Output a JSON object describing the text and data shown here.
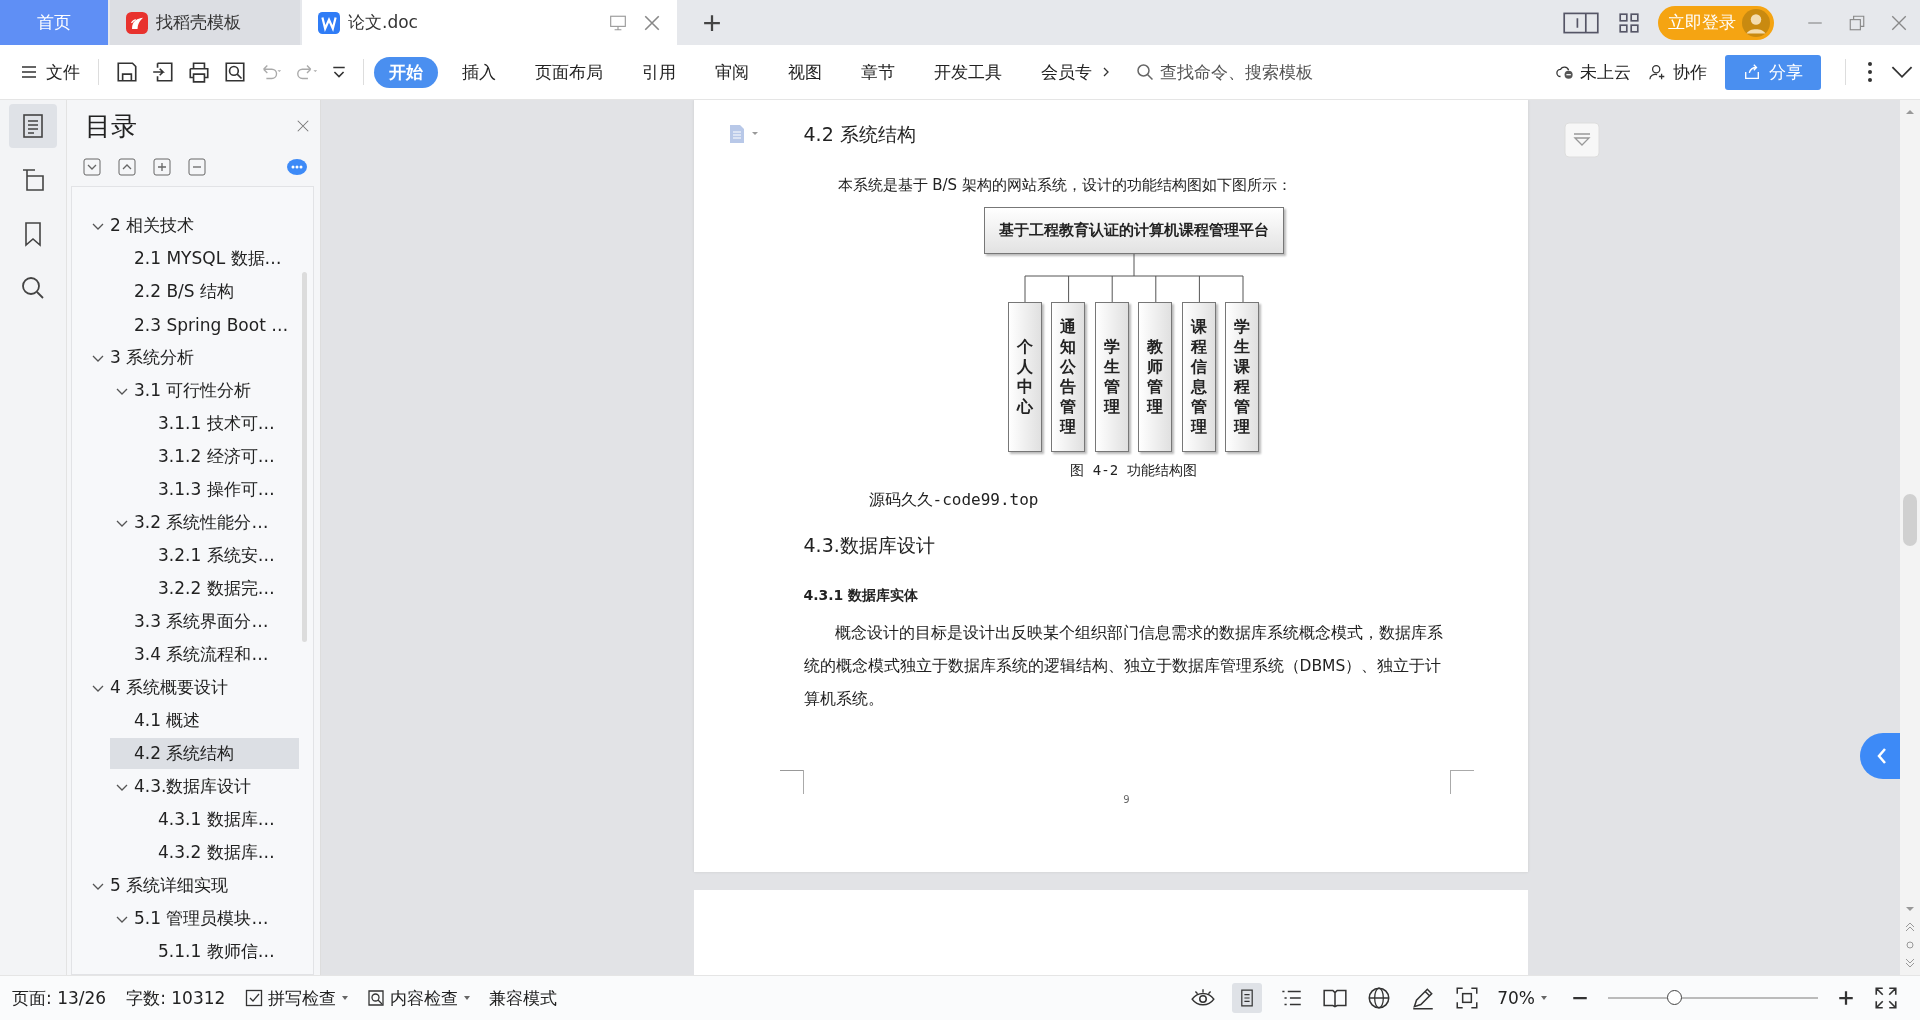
{
  "tabs": [
    {
      "label": "首页",
      "kind": "home",
      "selected": false
    },
    {
      "label": "找稻壳模板",
      "kind": "docer",
      "selected": false
    },
    {
      "label": "论文.doc",
      "kind": "document",
      "selected": true
    }
  ],
  "account": {
    "login": "立即登录"
  },
  "menu": {
    "file": "文件",
    "tabs": [
      {
        "label": "开始",
        "selected": true
      },
      {
        "label": "插入",
        "selected": false
      },
      {
        "label": "页面布局",
        "selected": false
      },
      {
        "label": "引用",
        "selected": false
      },
      {
        "label": "审阅",
        "selected": false
      },
      {
        "label": "视图",
        "selected": false
      },
      {
        "label": "章节",
        "selected": false
      },
      {
        "label": "开发工具",
        "selected": false
      },
      {
        "label": "会员专",
        "selected": false
      }
    ],
    "search": {
      "placeholder": "查找命令、搜索模板"
    },
    "cloud": "未上云",
    "collab": "协作",
    "share": "分享"
  },
  "toc": {
    "title": "目录",
    "items": [
      {
        "label": "2 相关技术",
        "expanded": true,
        "selected": false,
        "children": [
          {
            "label": "2.1 MYSQL 数据…",
            "selected": false
          },
          {
            "label": "2.2 B/S 结构",
            "selected": false
          },
          {
            "label": "2.3 Spring Boot …",
            "selected": false
          }
        ]
      },
      {
        "label": "3 系统分析",
        "expanded": true,
        "selected": false,
        "children": [
          {
            "label": "3.1 可行性分析",
            "expanded": true,
            "selected": false,
            "children": [
              {
                "label": "3.1.1 技术可…",
                "selected": false
              },
              {
                "label": "3.1.2 经济可…",
                "selected": false
              },
              {
                "label": "3.1.3 操作可…",
                "selected": false
              }
            ]
          },
          {
            "label": "3.2 系统性能分…",
            "expanded": true,
            "selected": false,
            "children": [
              {
                "label": "3.2.1  系统安…",
                "selected": false
              },
              {
                "label": "3.2.2  数据完…",
                "selected": false
              }
            ]
          },
          {
            "label": "3.3 系统界面分…",
            "selected": false
          },
          {
            "label": "3.4 系统流程和…",
            "selected": false
          }
        ]
      },
      {
        "label": "4 系统概要设计",
        "expanded": true,
        "selected": false,
        "children": [
          {
            "label": "4.1 概述",
            "selected": false
          },
          {
            "label": "4.2 系统结构",
            "selected": true
          },
          {
            "label": "4.3.数据库设计",
            "expanded": true,
            "selected": false,
            "children": [
              {
                "label": "4.3.1 数据库…",
                "selected": false
              },
              {
                "label": "4.3.2 数据库…",
                "selected": false
              }
            ]
          }
        ]
      },
      {
        "label": "5 系统详细实现",
        "expanded": true,
        "selected": false,
        "children": [
          {
            "label": "5.1  管理员模块…",
            "expanded": true,
            "selected": false,
            "children": [
              {
                "label": "5.1.1  教师信…",
                "selected": false
              }
            ]
          }
        ]
      }
    ]
  },
  "document": {
    "heading": "4.2 系统结构",
    "intro": "本系统是基于 B/S 架构的网站系统，设计的功能结构图如下图所示：",
    "diagram": {
      "root": "基于工程教育认证的计算机课程管理平台",
      "modules": [
        "个人中心",
        "通知公告管理",
        "学生管理",
        "教师管理",
        "课程信息管理",
        "学生课程管理"
      ]
    },
    "caption": "图 4-2 功能结构图",
    "source_note": "源码久久-code99.top",
    "heading_2": "4.3.数据库设计",
    "subheading": "4.3.1 数据库实体",
    "paragraph": "概念设计的目标是设计出反映某个组织部门信息需求的数据库系统概念模式，数据库系统的概念模式独立于数据库系统的逻辑结构、独立于数据库管理系统（DBMS）、独立于计算机系统。",
    "page_number": "9"
  },
  "status_bar": {
    "page": "页面: 13/26",
    "words": "字数: 10312",
    "spell_check": "拼写检查",
    "content_check": "内容检查",
    "mode": "兼容模式",
    "zoom": "70%",
    "zoom_slider": {
      "level": 0.32
    }
  }
}
